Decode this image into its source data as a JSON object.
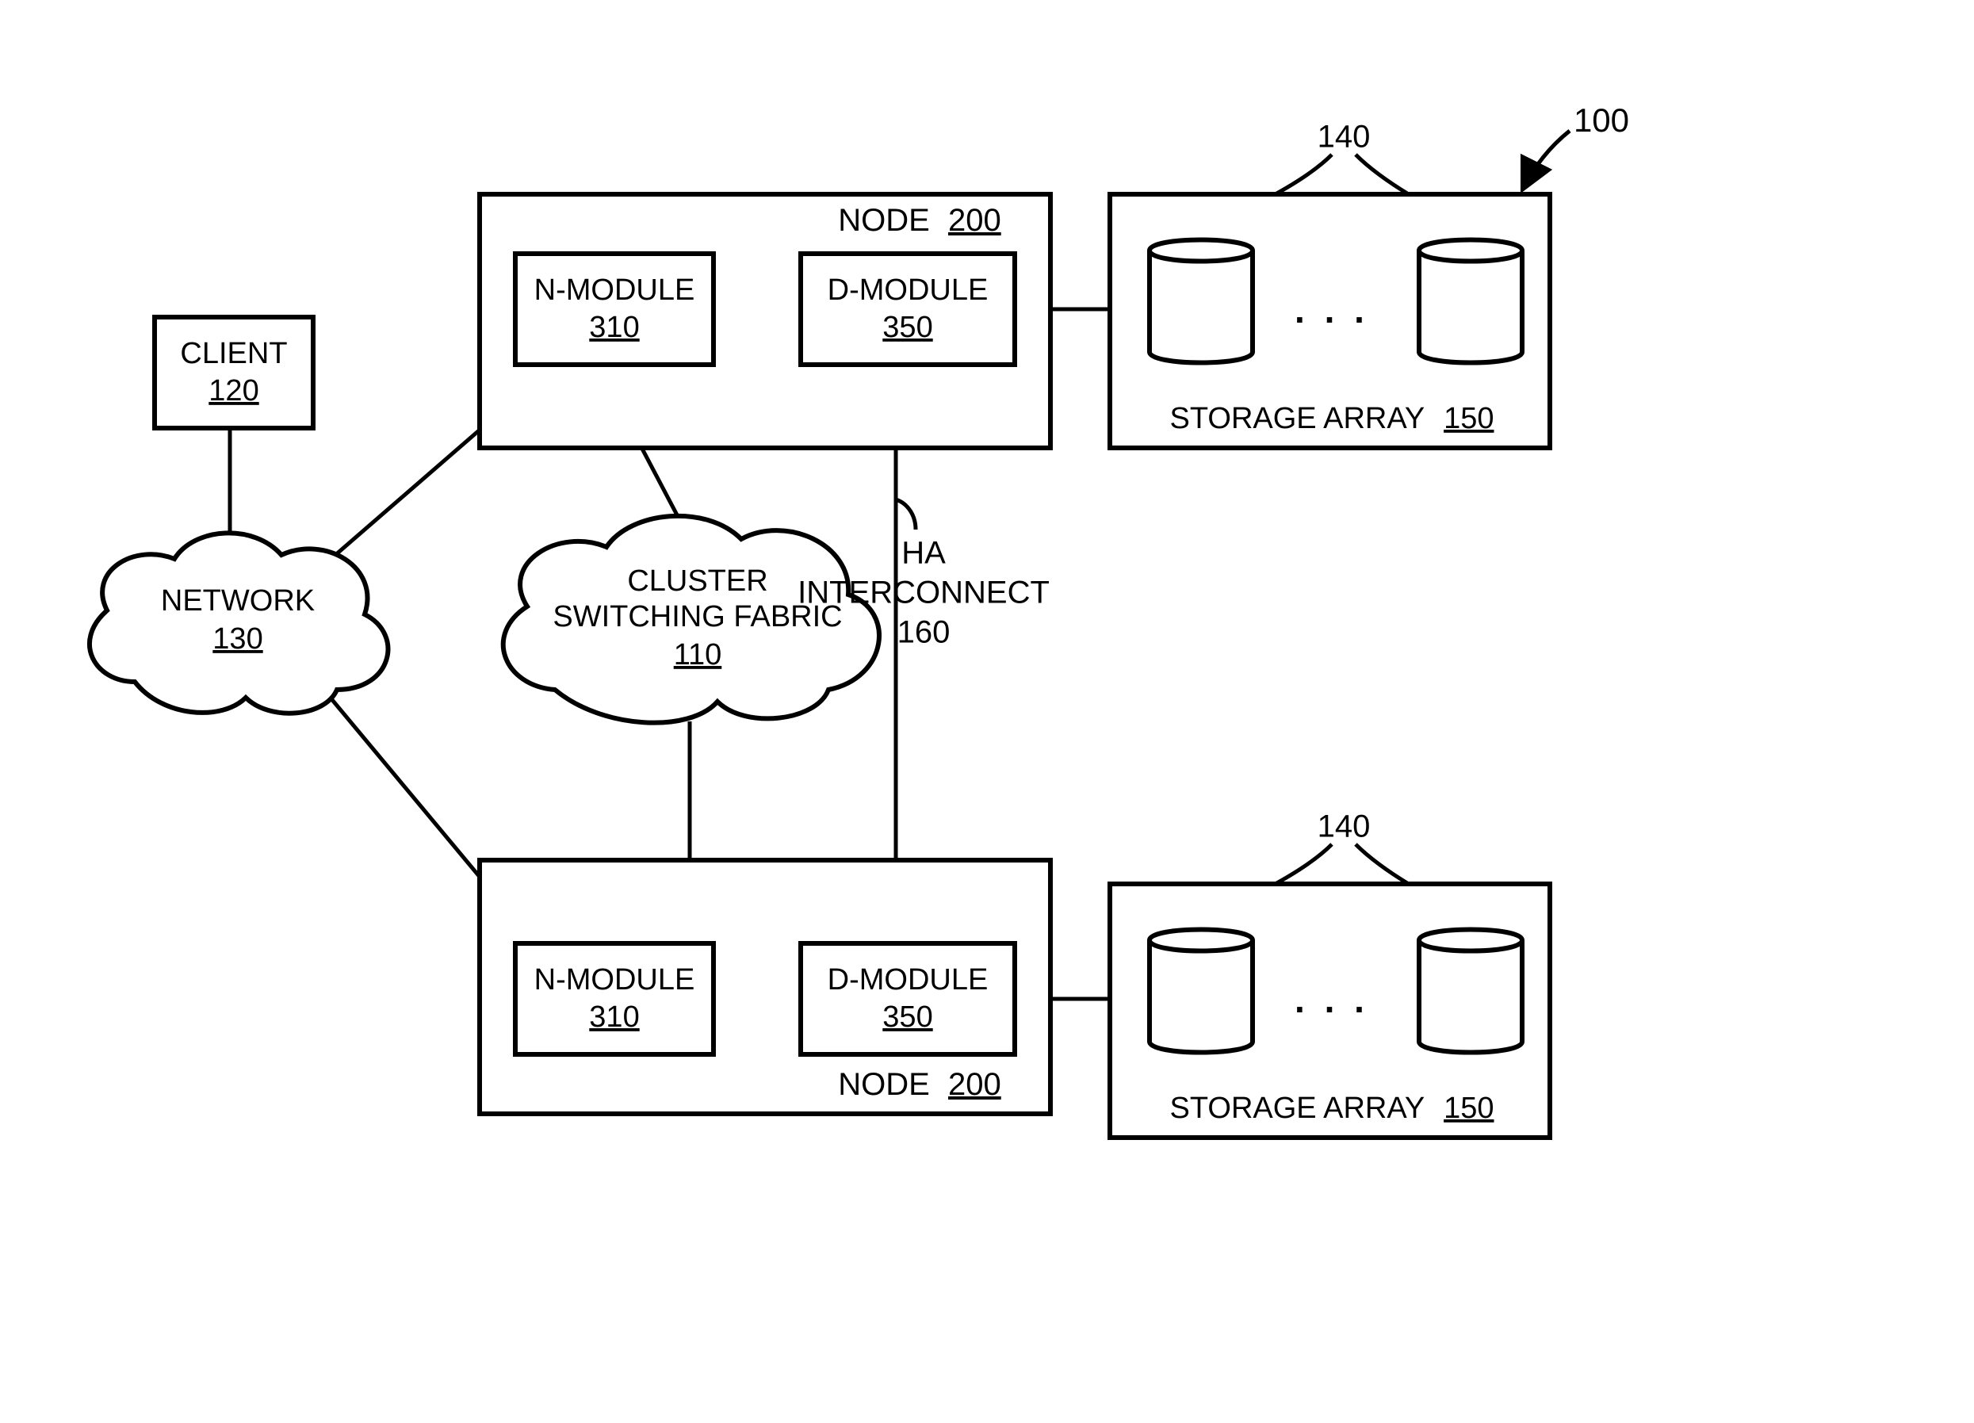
{
  "labels": {
    "client": "CLIENT",
    "client_ref": "120",
    "network": "NETWORK",
    "network_ref": "130",
    "cluster_l1": "CLUSTER",
    "cluster_l2": "SWITCHING FABRIC",
    "cluster_ref": "110",
    "node": "NODE",
    "node_ref": "200",
    "nmod": "N-MODULE",
    "nmod_ref": "310",
    "dmod": "D-MODULE",
    "dmod_ref": "350",
    "storage": "STORAGE ARRAY",
    "storage_ref": "150",
    "disk_ref": "140",
    "ha_l1": "HA",
    "ha_l2": "INTERCONNECT",
    "ha_ref": "160",
    "overall_ref": "100",
    "ellipsis": ". . ."
  }
}
